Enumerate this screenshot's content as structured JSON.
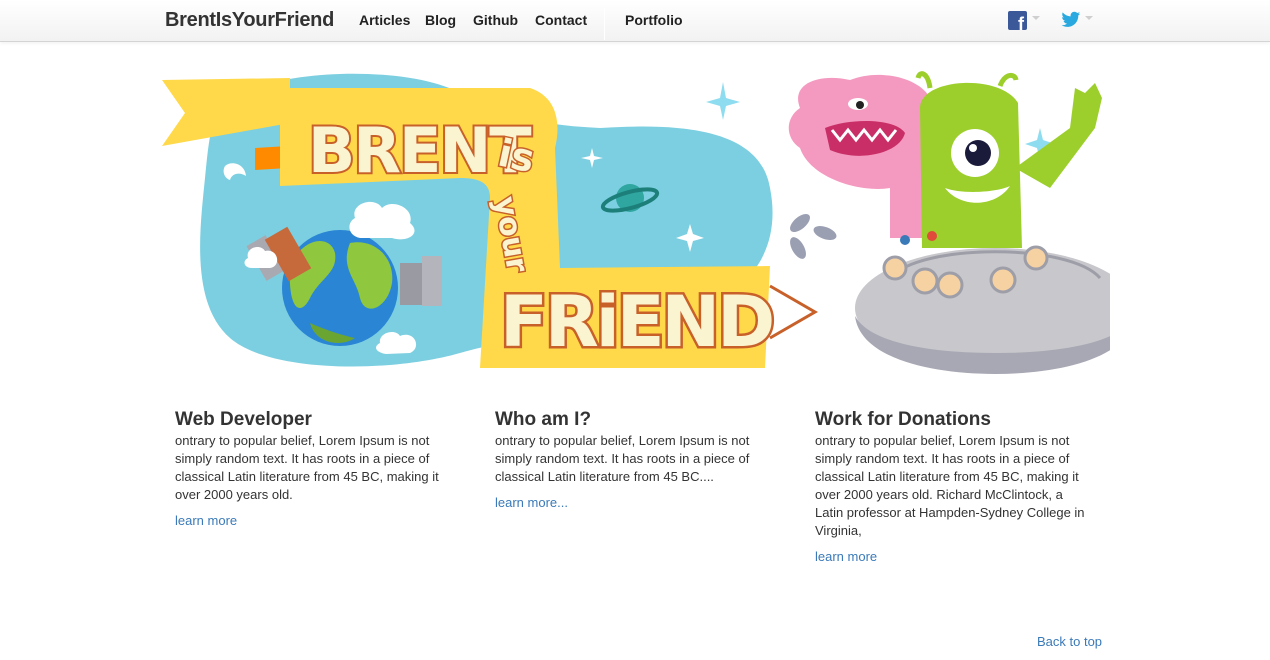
{
  "navbar": {
    "brand": "BrentIsYourFriend",
    "links": [
      "Articles",
      "Blog",
      "Github",
      "Contact"
    ],
    "portfolio": "Portfolio",
    "facebook_icon": "facebook-icon",
    "twitter_icon": "twitter-icon"
  },
  "hero": {
    "line1": "BRENT",
    "line2": "is",
    "line3": "your",
    "line4": "FRiEND",
    "colors": {
      "sky": "#7ccfe0",
      "banner": "#ffd94a",
      "lettering": "#c8602a",
      "letter_fill": "#fbf4d0",
      "alien_green": "#9ccf2b",
      "monster_pink": "#f49ac1",
      "ufo": "#c7c7cc"
    }
  },
  "columns": [
    {
      "title": "Web Developer",
      "text": "ontrary to popular belief, Lorem Ipsum is not simply random text. It has roots in a piece of classical Latin literature from 45 BC, making it over 2000 years old.",
      "link": "learn more"
    },
    {
      "title": "Who am I?",
      "text": "ontrary to popular belief, Lorem Ipsum is not simply random text. It has roots in a piece of classical Latin literature from 45 BC....",
      "link": "learn more..."
    },
    {
      "title": "Work for Donations",
      "text": "ontrary to popular belief, Lorem Ipsum is not simply random text. It has roots in a piece of classical Latin literature from 45 BC, making it over 2000 years old. Richard McClintock, a Latin professor at Hampden-Sydney College in Virginia,",
      "link": "learn more"
    }
  ],
  "footer": {
    "back_to_top": "Back to top"
  },
  "colors": {
    "link": "#3a7ab8",
    "text": "#333333"
  }
}
